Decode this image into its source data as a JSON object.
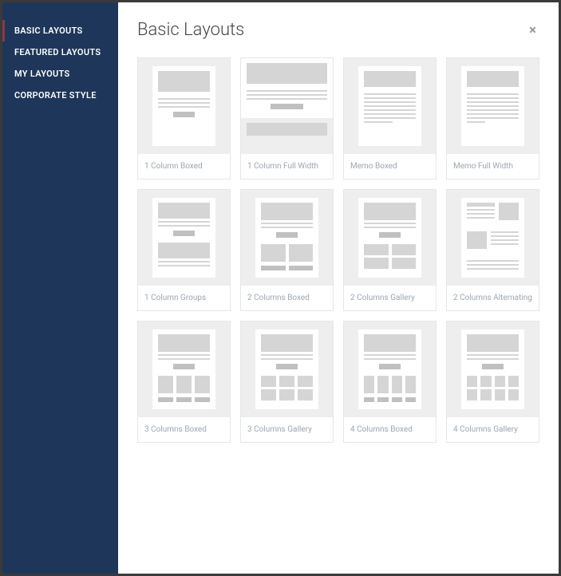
{
  "sidebar": {
    "items": [
      {
        "label": "BASIC LAYOUTS",
        "active": true
      },
      {
        "label": "FEATURED LAYOUTS",
        "active": false
      },
      {
        "label": "MY LAYOUTS",
        "active": false
      },
      {
        "label": "CORPORATE STYLE",
        "active": false
      }
    ]
  },
  "header": {
    "title": "Basic Layouts",
    "close": "×"
  },
  "layouts": [
    {
      "label": "1 Column Boxed"
    },
    {
      "label": "1 Column Full Width"
    },
    {
      "label": "Memo Boxed"
    },
    {
      "label": "Memo Full Width"
    },
    {
      "label": "1 Column Groups"
    },
    {
      "label": "2 Columns Boxed"
    },
    {
      "label": "2 Columns Gallery"
    },
    {
      "label": "2 Columns Alternating"
    },
    {
      "label": "3 Columns Boxed"
    },
    {
      "label": "3 Columns Gallery"
    },
    {
      "label": "4 Columns Boxed"
    },
    {
      "label": "4 Columns Gallery"
    }
  ]
}
